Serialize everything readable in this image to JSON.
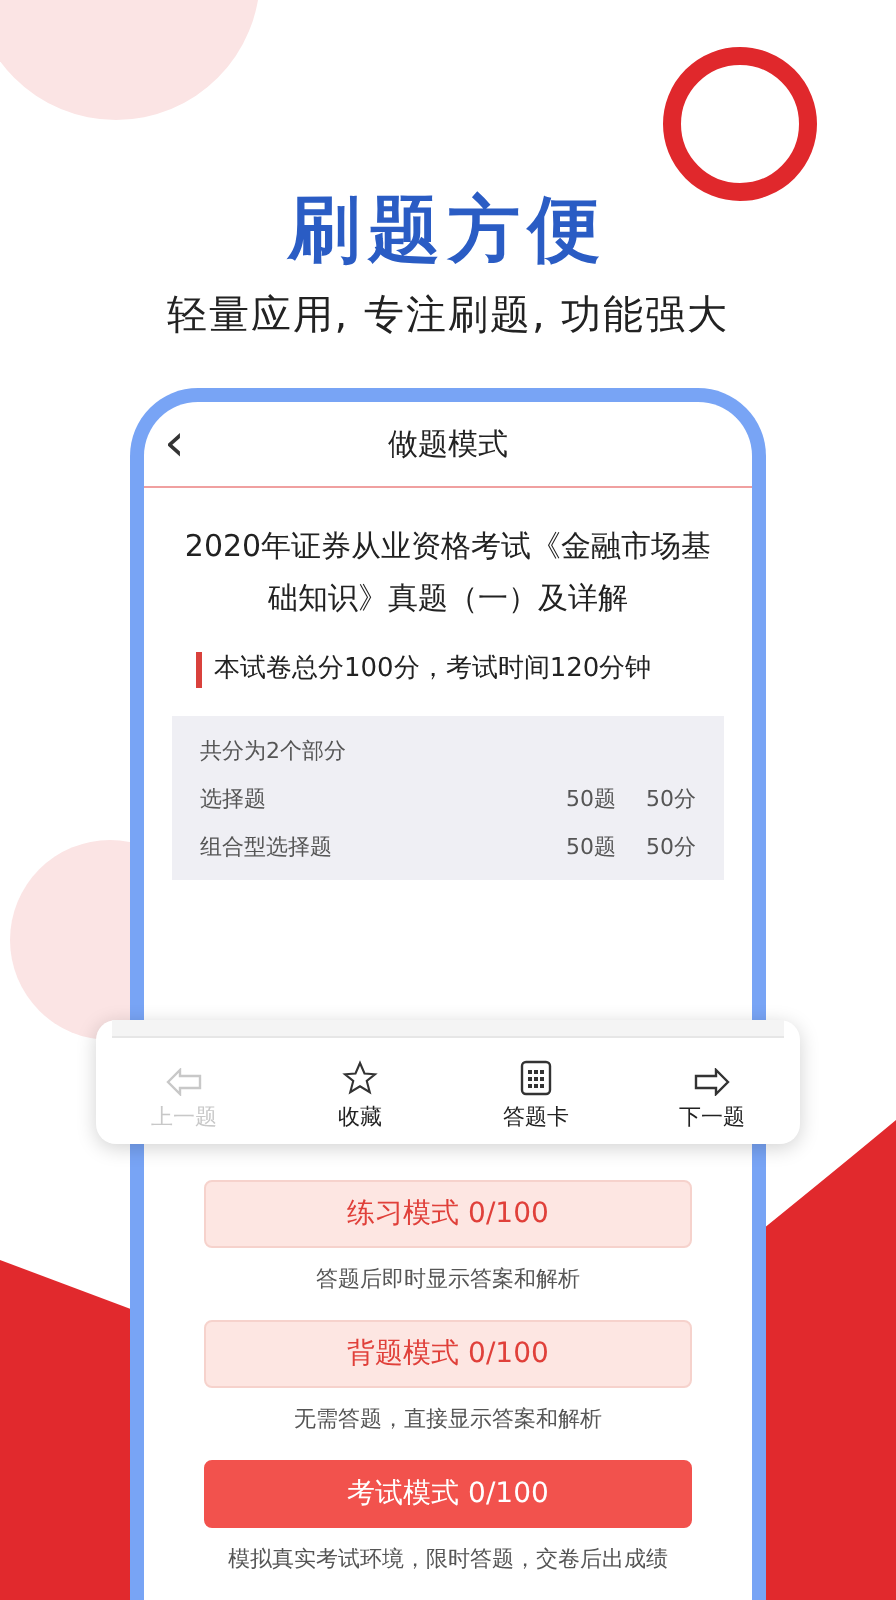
{
  "headline": "刷题方便",
  "tagline": "轻量应用, 专注刷题, 功能强大",
  "screen": {
    "back": "‹",
    "title": "做题模式"
  },
  "exam": {
    "title": "2020年证券从业资格考试《金融市场基础知识》真题（一）及详解",
    "info": "本试卷总分100分，考试时间120分钟"
  },
  "summary": {
    "heading": "共分为2个部分",
    "rows": [
      {
        "name": "选择题",
        "count": "50题",
        "score": "50分"
      },
      {
        "name": "组合型选择题",
        "count": "50题",
        "score": "50分"
      }
    ]
  },
  "toolbar": [
    {
      "kind": "prev",
      "label": "上一题",
      "disabled": true
    },
    {
      "kind": "star",
      "label": "收藏",
      "disabled": false
    },
    {
      "kind": "card",
      "label": "答题卡",
      "disabled": false
    },
    {
      "kind": "next",
      "label": "下一题",
      "disabled": false
    }
  ],
  "modes": [
    {
      "kind": "light",
      "label": "练习模式  0/100",
      "caption": "答题后即时显示答案和解析"
    },
    {
      "kind": "light",
      "label": "背题模式  0/100",
      "caption": "无需答题，直接显示答案和解析"
    },
    {
      "kind": "solid",
      "label": "考试模式  0/100",
      "caption": "模拟真实考试环境，限时答题，交卷后出成绩"
    }
  ]
}
